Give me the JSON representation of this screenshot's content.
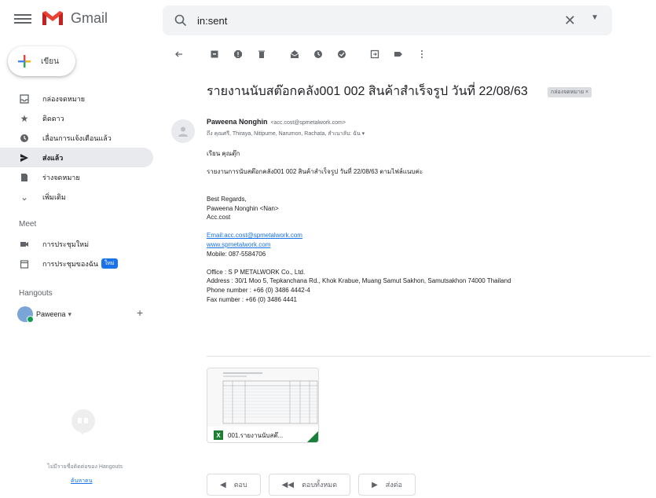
{
  "app": {
    "name": "Gmail"
  },
  "search": {
    "value": "in:sent"
  },
  "compose": {
    "label": "เขียน"
  },
  "nav": {
    "items": [
      {
        "label": "กล่องจดหมาย",
        "icon": "inbox-icon"
      },
      {
        "label": "ติดดาว",
        "icon": "star-icon"
      },
      {
        "label": "เลื่อนการแจ้งเตือนแล้ว",
        "icon": "clock-icon"
      },
      {
        "label": "ส่งแล้ว",
        "icon": "send-icon",
        "active": true
      },
      {
        "label": "ร่างจดหมาย",
        "icon": "draft-icon"
      },
      {
        "label": "เพิ่มเติม",
        "icon": "chevron-down-icon"
      }
    ]
  },
  "meet": {
    "title": "Meet",
    "items": [
      {
        "label": "การประชุมใหม่",
        "icon": "video-icon"
      },
      {
        "label": "การประชุมของฉัน",
        "icon": "calendar-icon",
        "badge": "ใหม่"
      }
    ]
  },
  "hangouts": {
    "title": "Hangouts",
    "user": "Paweena",
    "empty_text": "ไม่มีรายชื่อติดต่อของ Hangouts",
    "find_link": "ค้นหาคน"
  },
  "message": {
    "subject": "รายงานนับสต๊อกคลัง001 002 สินค้าสำเร็จรูป วันที่ 22/08/63",
    "label_chip": "กล่องจดหมาย ×",
    "sender_name": "Paweena Nonghin",
    "sender_email": "<acc.cost@spmetalwork.com>",
    "recipients": "ถึง คุณศรี, Thiraya, Nitipume, Narumon, Rachata, สำเนาลับ: ฉัน ▾",
    "body": [
      "เรียน คุณตุ๊ก",
      "",
      "รายงานการนับสต๊อกคลัง001 002 สินค้าสำเร็จรูป วันที่ 22/08/63 ตามไฟล์แนบค่ะ",
      "",
      "",
      "Best Regards,",
      "Paweena Nonghin  <Nan>",
      "Acc.cost",
      "",
      "Email:acc.cost@spmetalwork.com",
      "www.spmetalwork.com",
      "Mobile: 087-5584706",
      "",
      "Office : S P METALWORK Co., Ltd.",
      "Address : 30/1 Moo 5, Tepkanchana Rd., Khok Krabue, Muang Samut Sakhon, Samutsakhon 74000 Thailand",
      "Phone number : +66 (0) 3486 4442-4",
      "Fax number : +66 (0) 3486 4441"
    ],
    "attachment": {
      "name": "001.รายงานนับสต๊...",
      "type": "X"
    }
  },
  "actions": {
    "reply": "ตอบ",
    "reply_all": "ตอบทั้งหมด",
    "forward": "ส่งต่อ"
  },
  "colors": {
    "accent": "#1a73e8",
    "gmail_red": "#ea4335",
    "active_nav": "#e8eaed"
  }
}
